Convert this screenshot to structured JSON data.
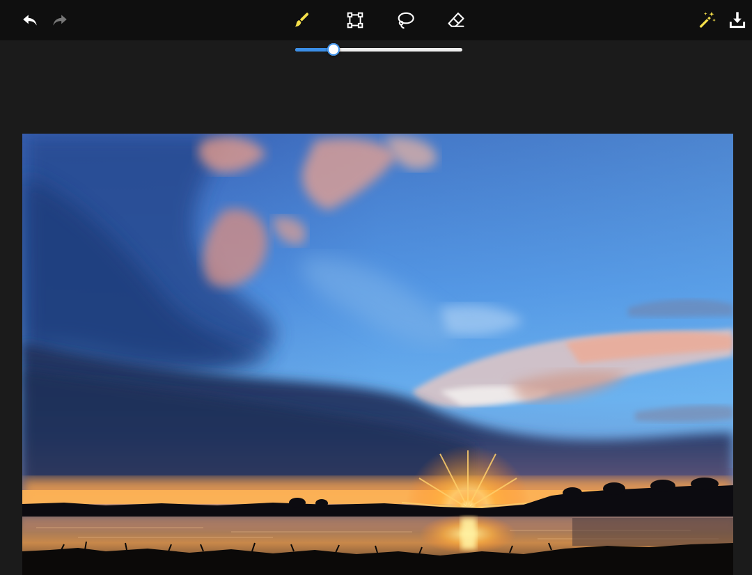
{
  "toolbar": {
    "history": [
      {
        "id": "undo",
        "icon": "undo-icon",
        "enabled": true
      },
      {
        "id": "redo",
        "icon": "redo-icon",
        "enabled": false
      }
    ],
    "tools": [
      {
        "id": "brush",
        "icon": "brush-icon",
        "active": true
      },
      {
        "id": "rect-select",
        "icon": "rect-select-icon",
        "active": false
      },
      {
        "id": "lasso",
        "icon": "lasso-icon",
        "active": false
      },
      {
        "id": "eraser",
        "icon": "eraser-icon",
        "active": false
      }
    ],
    "actions": [
      {
        "id": "magic-wand",
        "icon": "magic-wand-icon"
      },
      {
        "id": "download",
        "icon": "download-icon"
      }
    ],
    "colors": {
      "background": "#0f0f0f",
      "icon": "#ffffff",
      "icon_disabled": "#777777",
      "accent": "#f5e04a"
    }
  },
  "brush_size_slider": {
    "value": 0.23,
    "fill_color": "#3b8fe8",
    "track_color": "#eeeeee"
  },
  "canvas": {
    "image": "sunset-over-lake-photo",
    "background": "#1b1b1b"
  }
}
